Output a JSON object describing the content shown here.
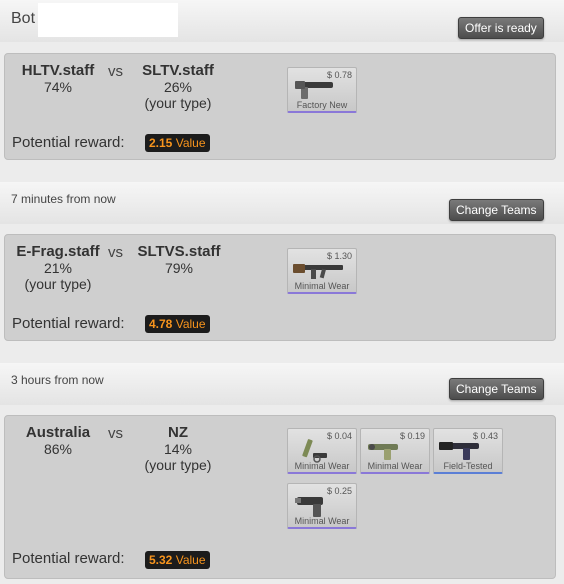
{
  "bot": {
    "label": "Bot",
    "input_value": "",
    "offer_button": "Offer is ready"
  },
  "matches": [
    {
      "team1": {
        "name": "HLTV.staff",
        "percent": "74%",
        "note": ""
      },
      "vs": "vs",
      "team2": {
        "name": "SLTV.staff",
        "percent": "26%",
        "note": "(your type)"
      },
      "items": [
        {
          "price": "$ 0.78",
          "wear": "Factory New",
          "icon": "pistol-icon"
        }
      ],
      "reward_label": "Potential reward:",
      "reward_amount": "2.15",
      "reward_unit": "Value"
    },
    {
      "time": "7 minutes from now",
      "change_button": "Change Teams",
      "team1": {
        "name": "E-Frag.staff",
        "percent": "21%",
        "note": "(your type)"
      },
      "vs": "vs",
      "team2": {
        "name": "SLTVS.staff",
        "percent": "79%",
        "note": ""
      },
      "items": [
        {
          "price": "$ 1.30",
          "wear": "Minimal Wear",
          "icon": "rifle-icon"
        }
      ],
      "reward_label": "Potential reward:",
      "reward_amount": "4.78",
      "reward_unit": "Value"
    },
    {
      "time": "3 hours from now",
      "change_button": "Change Teams",
      "team1": {
        "name": "Australia",
        "percent": "86%",
        "note": ""
      },
      "vs": "vs",
      "team2": {
        "name": "NZ",
        "percent": "14%",
        "note": "(your type)"
      },
      "items": [
        {
          "price": "$ 0.04",
          "wear": "Minimal Wear",
          "icon": "knife-pistol-icon"
        },
        {
          "price": "$ 0.19",
          "wear": "Minimal Wear",
          "icon": "pistol-icon"
        },
        {
          "price": "$ 0.43",
          "wear": "Field-Tested",
          "icon": "pistol-icon"
        },
        {
          "price": "$ 0.25",
          "wear": "Minimal Wear",
          "icon": "pistol-icon"
        }
      ],
      "reward_label": "Potential reward:",
      "reward_amount": "5.32",
      "reward_unit": "Value"
    }
  ],
  "colors": {
    "reward_text": "#f7941d",
    "item_border": "#8a78d8"
  }
}
